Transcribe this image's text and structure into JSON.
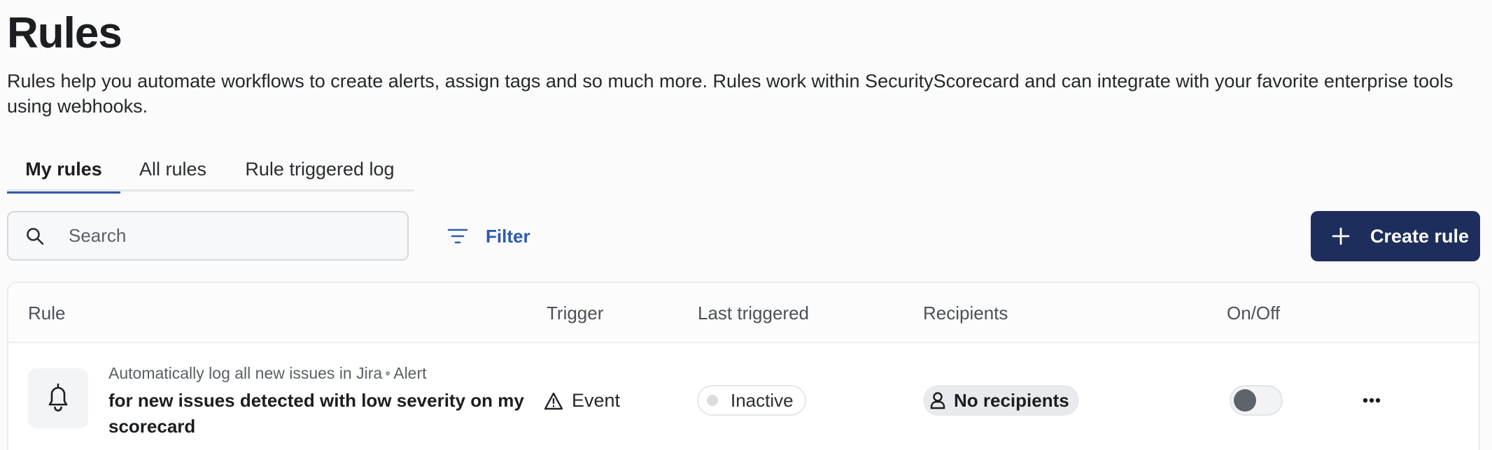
{
  "page": {
    "title": "Rules",
    "description": "Rules help you automate workflows to create alerts, assign tags and so much more. Rules work within SecurityScorecard and can integrate with your favorite enterprise tools using webhooks."
  },
  "tabs": [
    {
      "label": "My rules",
      "active": true
    },
    {
      "label": "All rules",
      "active": false
    },
    {
      "label": "Rule triggered log",
      "active": false
    }
  ],
  "toolbar": {
    "search_placeholder": "Search",
    "filter_label": "Filter",
    "create_label": "Create rule"
  },
  "table": {
    "columns": [
      "Rule",
      "Trigger",
      "Last triggered",
      "Recipients",
      "On/Off"
    ],
    "rows": [
      {
        "rule_subtitle": "Automatically log all new issues in Jira",
        "rule_type": "Alert",
        "rule_title": "for new issues detected with low severity on my scorecard",
        "trigger": "Event",
        "last_triggered": "Inactive",
        "recipients": "No recipients",
        "enabled": false
      }
    ]
  },
  "icons": {
    "search": "search-icon",
    "filter": "filter-icon",
    "create": "plus-icon",
    "rule": "bell-icon",
    "trigger": "warning-triangle-icon",
    "recipients": "person-icon",
    "menu": "more-dots-icon"
  },
  "colors": {
    "accent": "#2f5aa8",
    "primary_button": "#1d2e5c",
    "filter_text": "#2d5bb0"
  }
}
